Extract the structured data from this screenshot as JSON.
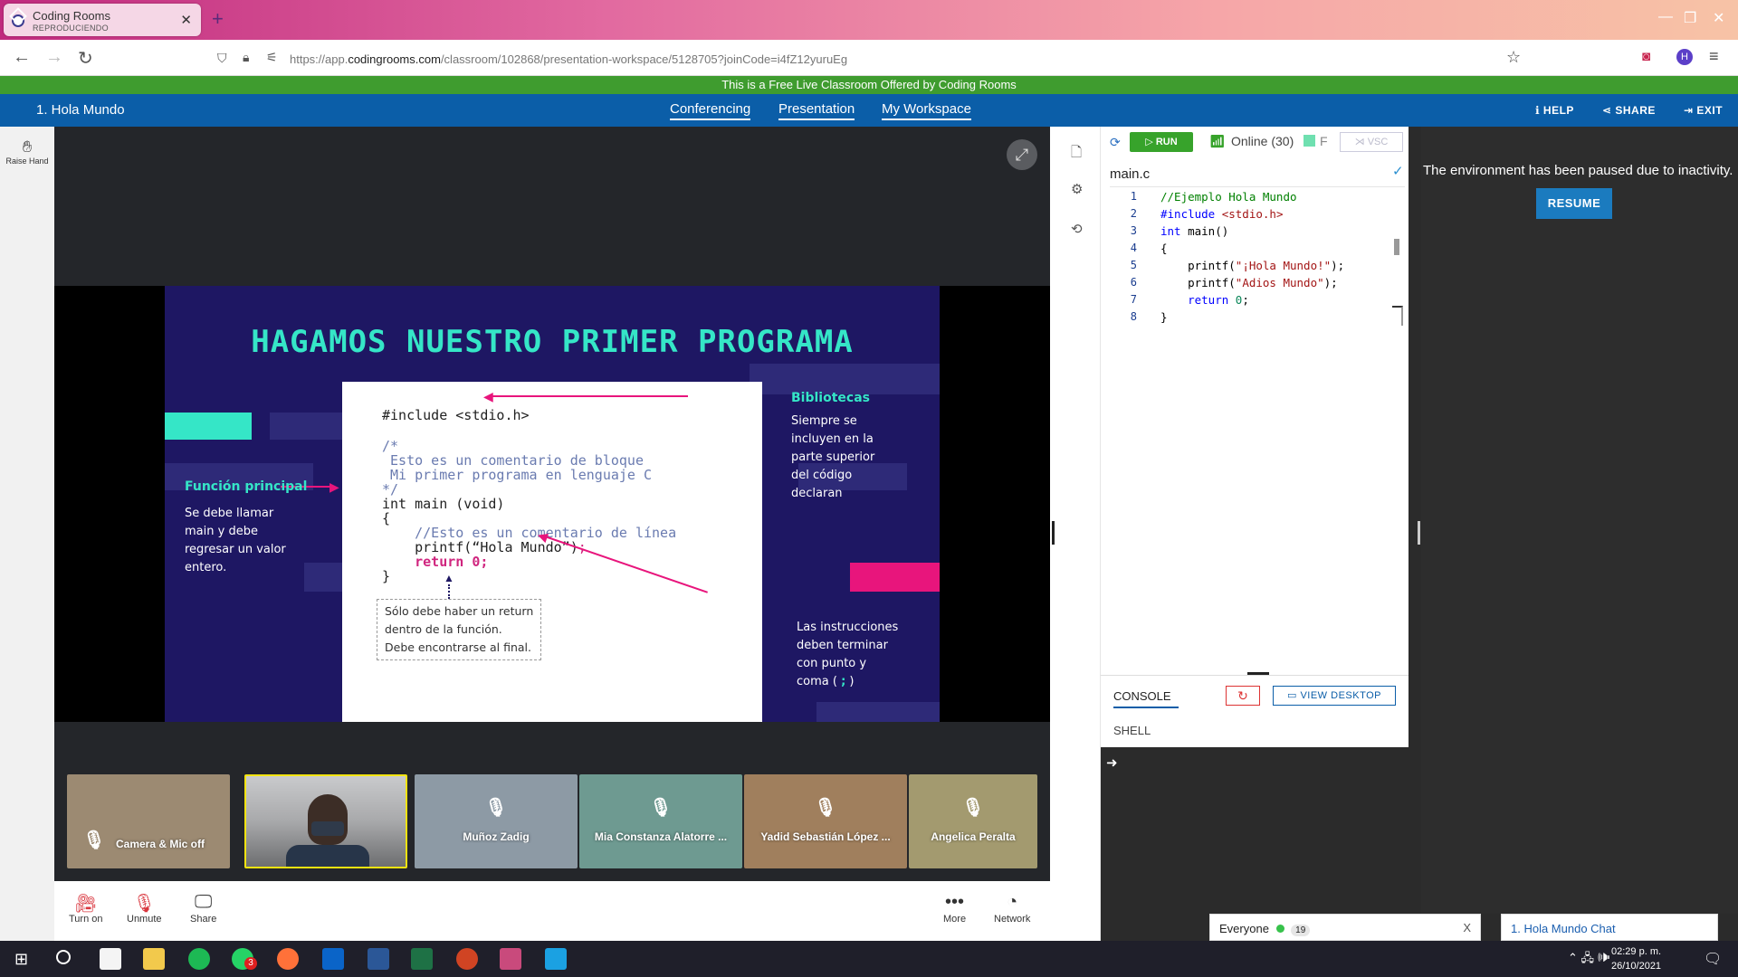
{
  "browser": {
    "tab_title": "Coding Rooms",
    "tab_subtitle": "REPRODUCIENDO",
    "url_prefix": "https://app.",
    "url_domain": "codingrooms.com",
    "url_rest": "/classroom/102868/presentation-workspace/5128705?joinCode=i4fZ12yuruEg",
    "profile_initial": "H"
  },
  "banner": "This is a Free Live Classroom Offered by Coding Rooms",
  "header": {
    "title": "1. Hola Mundo",
    "tabs": [
      "Conferencing",
      "Presentation",
      "My Workspace"
    ],
    "help": "HELP",
    "share": "SHARE",
    "exit": "EXIT"
  },
  "left_rail": {
    "raise_hand": "Raise Hand"
  },
  "slide": {
    "title": "HAGAMOS NUESTRO PRIMER PROGRAMA",
    "code": {
      "include": "#include <stdio.h>",
      "c1": "/*",
      "c2": " Esto es un comentario de bloque",
      "c3": " Mi primer programa en lenguaje C",
      "c4": "*/",
      "main": "int main (void)",
      "open": "{",
      "linec": "    //Esto es un comentario de línea",
      "printf": "    printf(“Hola Mundo”)",
      "semi1": ";",
      "ret": "    return 0",
      "semi2": ";",
      "close": "}"
    },
    "note": [
      "Sólo debe haber un return",
      "dentro de la función.",
      "Debe encontrarse al final."
    ],
    "bibliotecas_title": "Bibliotecas",
    "bibliotecas_text": [
      "Siempre se",
      "incluyen en la",
      "parte superior",
      "del código",
      "declaran"
    ],
    "funcion_title": "Función principal",
    "funcion_text": [
      "Se debe llamar",
      "main y debe",
      "regresar un valor",
      "entero."
    ],
    "instr_text": [
      "Las instrucciones",
      "deben terminar",
      "con punto y"
    ],
    "instr_last": "coma (",
    "instr_semi": ";",
    "instr_end": ")"
  },
  "participants": [
    {
      "name": "Camera & Mic off",
      "bg": "#9c8a72"
    },
    {
      "name": "",
      "bg": "#8e8f92"
    },
    {
      "name": "Muñoz Zadig",
      "bg": "#8d9aa5"
    },
    {
      "name": "Mia Constanza Alatorre ...",
      "bg": "#6e9a91"
    },
    {
      "name": "Yadid Sebastián López ...",
      "bg": "#a07f5d"
    },
    {
      "name": "Angelica Peralta",
      "bg": "#a39a6f"
    }
  ],
  "controls": {
    "turn_on": "Turn on",
    "unmute": "Unmute",
    "share": "Share",
    "more": "More",
    "network": "Network"
  },
  "editor": {
    "run": "RUN",
    "online": "Online (30)",
    "f": "F",
    "vsc": "VSC",
    "file": "main.c",
    "line_numbers": [
      "1",
      "2",
      "3",
      "4",
      "5",
      "6",
      "7",
      "8"
    ],
    "lines": {
      "l1": "//Ejemplo Hola Mundo",
      "l2a": "#include ",
      "l2b": "<stdio.h>",
      "l3a": "int",
      "l3b": " main()",
      "l4": "{",
      "l5a": "    printf(",
      "l5b": "\"¡Hola Mundo!\"",
      "l5c": ");",
      "l6a": "    printf(",
      "l6b": "\"Adios Mundo\"",
      "l6c": ");",
      "l7a": "    return ",
      "l7b": "0",
      "l7c": ";",
      "l8": "}"
    },
    "console_tab": "CONSOLE",
    "view_desktop": "VIEW DESKTOP",
    "shell_tab": "SHELL",
    "prompt": "➜"
  },
  "right_panel": {
    "paused": "The environment has been paused due to inactivity.",
    "resume": "RESUME"
  },
  "chat": {
    "everyone": "Everyone",
    "count": "19",
    "close": "X",
    "chat_title": "1. Hola Mundo Chat"
  },
  "taskbar": {
    "time": "02:29 p. m.",
    "date": "26/10/2021",
    "whatsapp_badge": "3"
  },
  "colors": {
    "banner": "#3f9c2f",
    "header": "#0b5ea8",
    "slide_bg": "#1e1763",
    "accent_teal": "#35e6c7",
    "accent_pink": "#e8157c",
    "run_green": "#37a32b"
  }
}
